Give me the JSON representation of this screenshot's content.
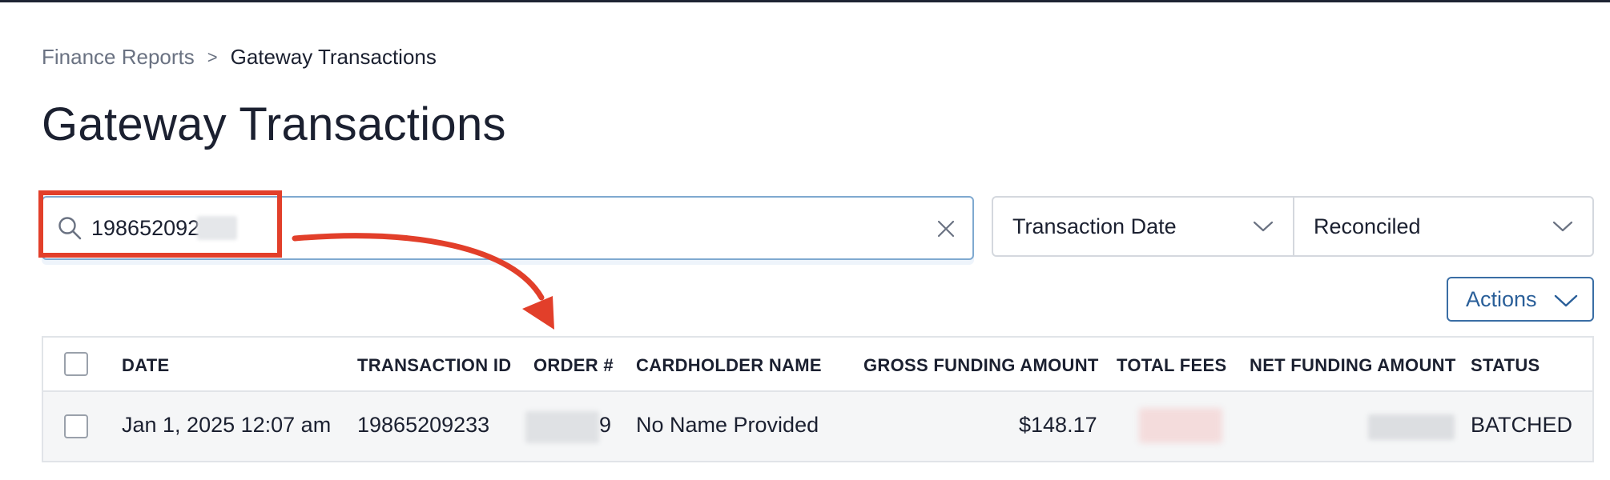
{
  "breadcrumb": {
    "parent": "Finance Reports",
    "separator": ">",
    "current": "Gateway Transactions"
  },
  "page": {
    "title": "Gateway Transactions"
  },
  "search": {
    "value": "198652092",
    "icon": "search-icon",
    "clear_icon": "close-icon"
  },
  "filters": {
    "date_filter": "Transaction Date",
    "status_filter": "Reconciled"
  },
  "actions": {
    "label": "Actions"
  },
  "table": {
    "headers": {
      "date": "DATE",
      "transaction_id": "TRANSACTION ID",
      "order": "ORDER #",
      "cardholder": "CARDHOLDER NAME",
      "gross": "GROSS FUNDING AMOUNT",
      "fees": "TOTAL FEES",
      "net": "NET FUNDING AMOUNT",
      "status": "STATUS"
    },
    "rows": [
      {
        "date": "Jan 1, 2025 12:07 am",
        "transaction_id": "19865209233",
        "order_visible": "9",
        "cardholder": "No Name Provided",
        "gross": "$148.17",
        "status": "BATCHED"
      }
    ]
  },
  "colors": {
    "accent": "#2a5f99",
    "search_border": "#7fa9d0",
    "annotation": "#e23f2a"
  }
}
